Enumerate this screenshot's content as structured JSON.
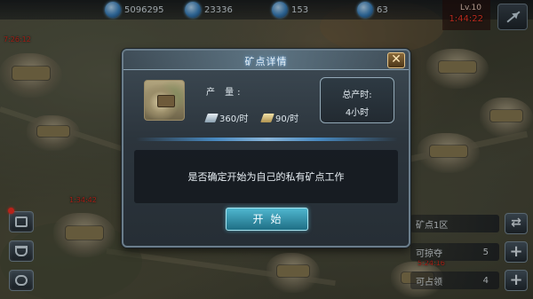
{
  "resources": [
    {
      "icon": "silver-coin-icon",
      "value": "5096295"
    },
    {
      "icon": "oil-icon",
      "value": "23336"
    },
    {
      "icon": "steel-icon",
      "value": "153"
    },
    {
      "icon": "crystal-icon",
      "value": "63"
    }
  ],
  "top_timer": {
    "top": "Lv.10",
    "red": "1:44:22"
  },
  "map_labels": [
    {
      "text": "7:26:12"
    },
    {
      "text": "5:24:16"
    },
    {
      "text": "1:34:42"
    }
  ],
  "dialog": {
    "title": "矿点详情",
    "close_label": "✕",
    "production_label": "产  量:",
    "rate_silver": "360/时",
    "rate_gold": "90/时",
    "total_label": "总产时:",
    "total_value": "4小时",
    "message": "是否确定开始为自己的私有矿点工作",
    "start_label": "开始"
  },
  "right_panel": [
    {
      "label": "矿点1区",
      "num": ""
    },
    {
      "label": "可掠夺",
      "num": "5"
    },
    {
      "label": "可占领",
      "num": "4"
    }
  ],
  "colors": {
    "accent": "#4fb6cf",
    "alert": "#ff3b2a",
    "panel": "#2c353d"
  }
}
